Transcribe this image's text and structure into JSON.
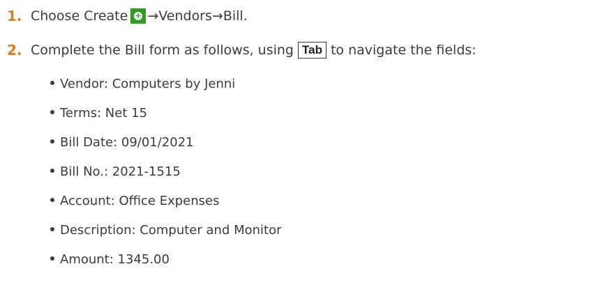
{
  "steps": [
    {
      "number": "1.",
      "text_before": "Choose Create",
      "icon": "create-plus-icon",
      "text_after": "→Vendors→Bill."
    },
    {
      "number": "2.",
      "text_before": "Complete the Bill form as follows, using",
      "key": "Tab",
      "text_after": "to navigate the fields:"
    }
  ],
  "bullets": [
    "Vendor: Computers by Jenni",
    "Terms: Net 15",
    "Bill Date: 09/01/2021",
    "Bill No.: 2021-1515",
    "Account: Office Expenses",
    "Description: Computer and Monitor",
    "Amount: 1345.00"
  ],
  "colors": {
    "step_number": "#e07b1a",
    "create_icon_bg": "#2ca01c",
    "text": "#3c3c3c"
  }
}
